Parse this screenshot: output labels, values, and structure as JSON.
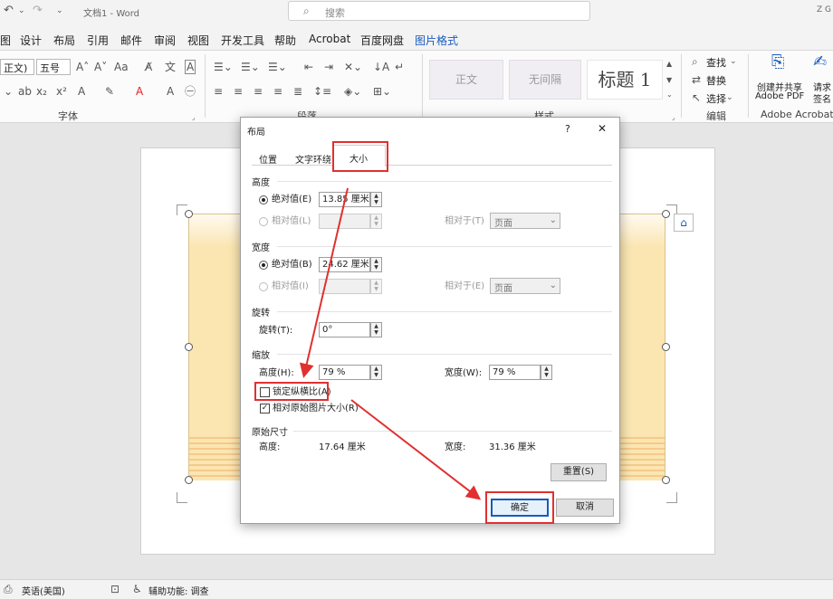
{
  "titlebar": {
    "doc_title": "文档1 - Word",
    "search_placeholder": "搜索",
    "right_edge": "Z G"
  },
  "menu": [
    "图",
    "设计",
    "布局",
    "引用",
    "邮件",
    "审阅",
    "视图",
    "开发工具",
    "帮助",
    "Acrobat",
    "百度网盘",
    "图片格式"
  ],
  "ribbon": {
    "font_name": "正文)",
    "font_size": "五号",
    "group_font": "字体",
    "group_para": "段落",
    "group_style": "样式",
    "group_edit": "编辑",
    "group_acrobat": "Adobe Acrobat",
    "styles": [
      "正文",
      "无间隔",
      "标题 1"
    ],
    "find": "查找",
    "replace": "替换",
    "select": "选择",
    "create_pdf_line1": "创建并共享",
    "create_pdf_line2": "Adobe PDF",
    "request_line1": "请求",
    "request_line2": "签名"
  },
  "dialog": {
    "title": "布局",
    "help": "?",
    "close": "✕",
    "tabs": [
      "位置",
      "文字环绕",
      "大小"
    ],
    "height_section": "高度",
    "height_abs_label": "绝对值(E)",
    "height_abs_value": "13.85 厘米",
    "height_rel_label": "相对值(L)",
    "height_rel_to_label": "相对于(T)",
    "height_rel_to_value": "页面",
    "width_section": "宽度",
    "width_abs_label": "绝对值(B)",
    "width_abs_value": "24.62 厘米",
    "width_rel_label": "相对值(I)",
    "width_rel_to_label": "相对于(E)",
    "width_rel_to_value": "页面",
    "rotate_section": "旋转",
    "rotate_label": "旋转(T):",
    "rotate_value": "0°",
    "scale_section": "缩放",
    "scale_height_label": "高度(H):",
    "scale_height_value": "79 %",
    "scale_width_label": "宽度(W):",
    "scale_width_value": "79 %",
    "lock_ratio_label": "锁定纵横比(A)",
    "relative_original_label": "相对原始图片大小(R)",
    "original_section": "原始尺寸",
    "orig_height_label": "高度:",
    "orig_height_value": "17.64 厘米",
    "orig_width_label": "宽度:",
    "orig_width_value": "31.36 厘米",
    "reset_button": "重置(S)",
    "ok_button": "确定",
    "cancel_button": "取消"
  },
  "statusbar": {
    "language": "英语(美国)",
    "accessibility": "辅助功能: 调查"
  },
  "colors": {
    "accent": "#185abd",
    "annotation_red": "#e03030",
    "picture_fill": "#fbe6b2"
  }
}
